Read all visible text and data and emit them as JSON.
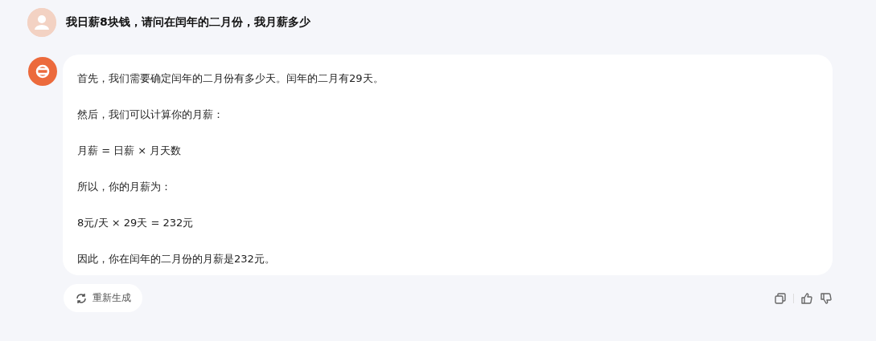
{
  "question": {
    "text": "我日薪8块钱，请问在闰年的二月份，我月薪多少"
  },
  "answer": {
    "paragraphs": [
      "首先，我们需要确定闰年的二月份有多少天。闰年的二月有29天。",
      "然后，我们可以计算你的月薪：",
      "月薪 = 日薪 × 月天数",
      "所以，你的月薪为：",
      "8元/天 × 29天 = 232元",
      "因此，你在闰年的二月份的月薪是232元。"
    ]
  },
  "actions": {
    "regenerate": "重新生成"
  }
}
